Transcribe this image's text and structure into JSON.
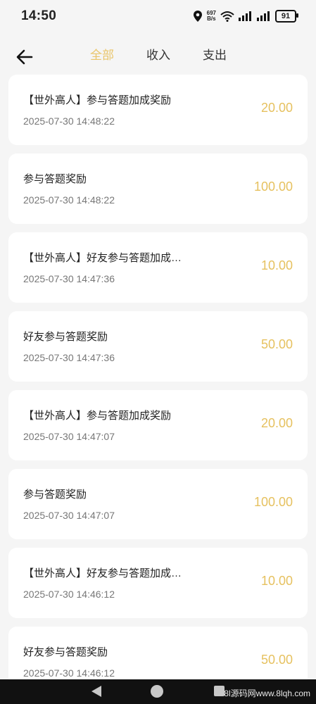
{
  "status_bar": {
    "time": "14:50",
    "net_speed_value": "697",
    "net_speed_unit": "B/s",
    "battery": "91"
  },
  "header": {
    "tabs": [
      {
        "label": "全部",
        "active": true
      },
      {
        "label": "收入",
        "active": false
      },
      {
        "label": "支出",
        "active": false
      }
    ]
  },
  "records": [
    {
      "title": "【世外高人】参与答题加成奖励",
      "time": "2025-07-30 14:48:22",
      "amount": "20.00"
    },
    {
      "title": "参与答题奖励",
      "time": "2025-07-30 14:48:22",
      "amount": "100.00"
    },
    {
      "title": "【世外高人】好友参与答题加成…",
      "time": "2025-07-30 14:47:36",
      "amount": "10.00"
    },
    {
      "title": "好友参与答题奖励",
      "time": "2025-07-30 14:47:36",
      "amount": "50.00"
    },
    {
      "title": "【世外高人】参与答题加成奖励",
      "time": "2025-07-30 14:47:07",
      "amount": "20.00"
    },
    {
      "title": "参与答题奖励",
      "time": "2025-07-30 14:47:07",
      "amount": "100.00"
    },
    {
      "title": "【世外高人】好友参与答题加成…",
      "time": "2025-07-30 14:46:12",
      "amount": "10.00"
    },
    {
      "title": "好友参与答题奖励",
      "time": "2025-07-30 14:46:12",
      "amount": "50.00"
    }
  ],
  "watermark": "8l源码网www.8lqh.com",
  "colors": {
    "accent": "#e6c15f",
    "background": "#f5f5f5"
  }
}
